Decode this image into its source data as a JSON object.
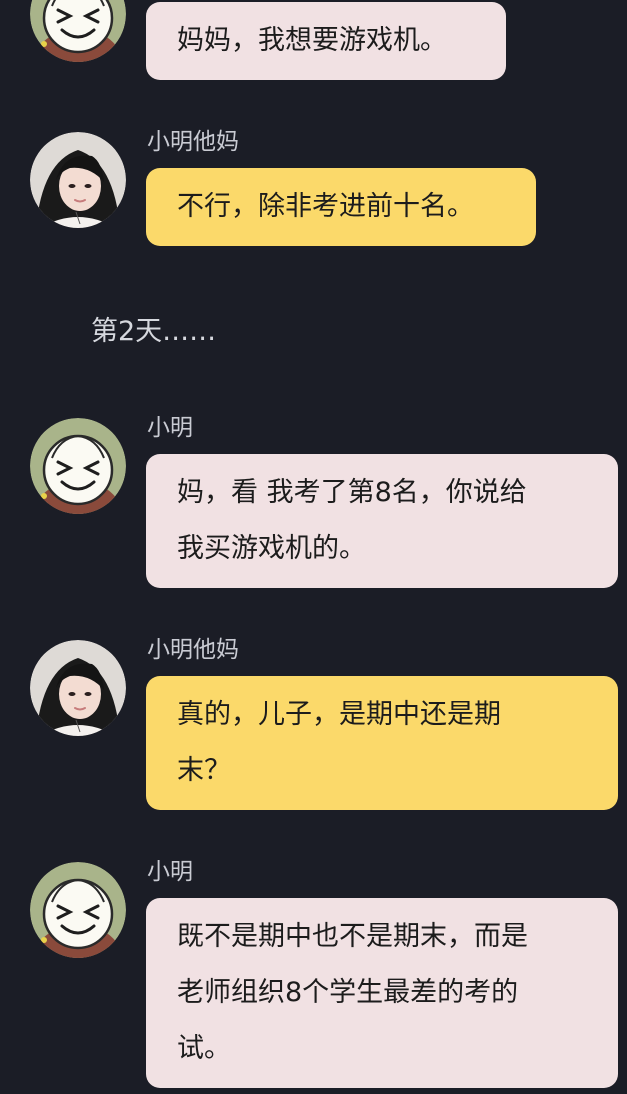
{
  "messages": [
    {
      "sender": "",
      "avatar": "xiaoming-avatar",
      "bubble_color": "#f1e1e3",
      "lines": [
        "妈妈，我想要游戏机。"
      ]
    },
    {
      "sender": "小明他妈",
      "avatar": "mom-avatar",
      "bubble_color": "#fbd96a",
      "lines": [
        "不行，除非考进前十名。"
      ]
    },
    {
      "sender": "小明",
      "avatar": "xiaoming-avatar",
      "bubble_color": "#f1e1e3",
      "lines": [
        "妈，看 我考了第8名，你说给",
        "我买游戏机的。"
      ]
    },
    {
      "sender": "小明他妈",
      "avatar": "mom-avatar",
      "bubble_color": "#fbd96a",
      "lines": [
        "真的，儿子，是期中还是期",
        "末？"
      ]
    },
    {
      "sender": "小明",
      "avatar": "xiaoming-avatar",
      "bubble_color": "#f1e1e3",
      "lines": [
        "既不是期中也不是期末，而是",
        "老师组织8个学生最差的考的",
        "试。"
      ]
    }
  ],
  "divider": "第2天……",
  "colors": {
    "background": "#1b1d26",
    "bubble_pink": "#f1e1e3",
    "bubble_yellow": "#fbd96a"
  }
}
